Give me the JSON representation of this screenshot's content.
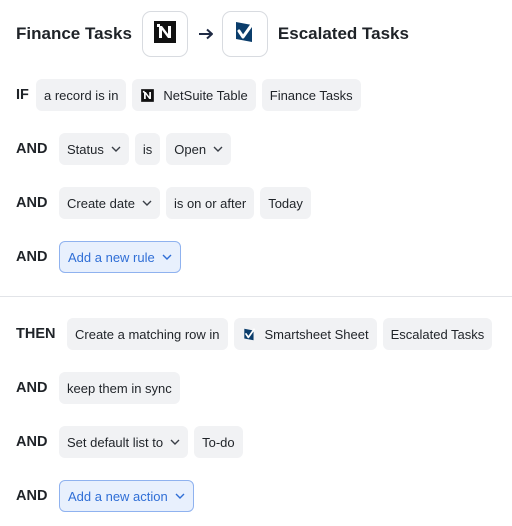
{
  "header": {
    "source_title": "Finance Tasks",
    "target_title": "Escalated Tasks",
    "source_icon": "netsuite-icon",
    "target_icon": "smartsheet-icon",
    "arrow_icon": "arrow-right-icon"
  },
  "conditions": {
    "if_keyword": "IF",
    "if_chips": [
      "a record is in",
      "NetSuite Table",
      "Finance Tasks"
    ],
    "and_keyword": "AND",
    "rule1": {
      "field": "Status",
      "operator": "is",
      "value": "Open"
    },
    "rule2": {
      "field": "Create date",
      "operator": "is on or after",
      "value": "Today"
    },
    "add_rule_label": "Add a new rule"
  },
  "actions": {
    "then_keyword": "THEN",
    "then_chips": [
      "Create a matching row in",
      "Smartsheet Sheet",
      "Escalated Tasks"
    ],
    "and_keyword": "AND",
    "sync_label": "keep them in sync",
    "default_list": {
      "label": "Set default list to",
      "value": "To-do"
    },
    "add_action_label": "Add a new action"
  },
  "colors": {
    "accent": "#2f6ed6",
    "accent_bg": "#e8f0fd",
    "chip_bg": "#f1f2f4",
    "text": "#1f2328"
  }
}
